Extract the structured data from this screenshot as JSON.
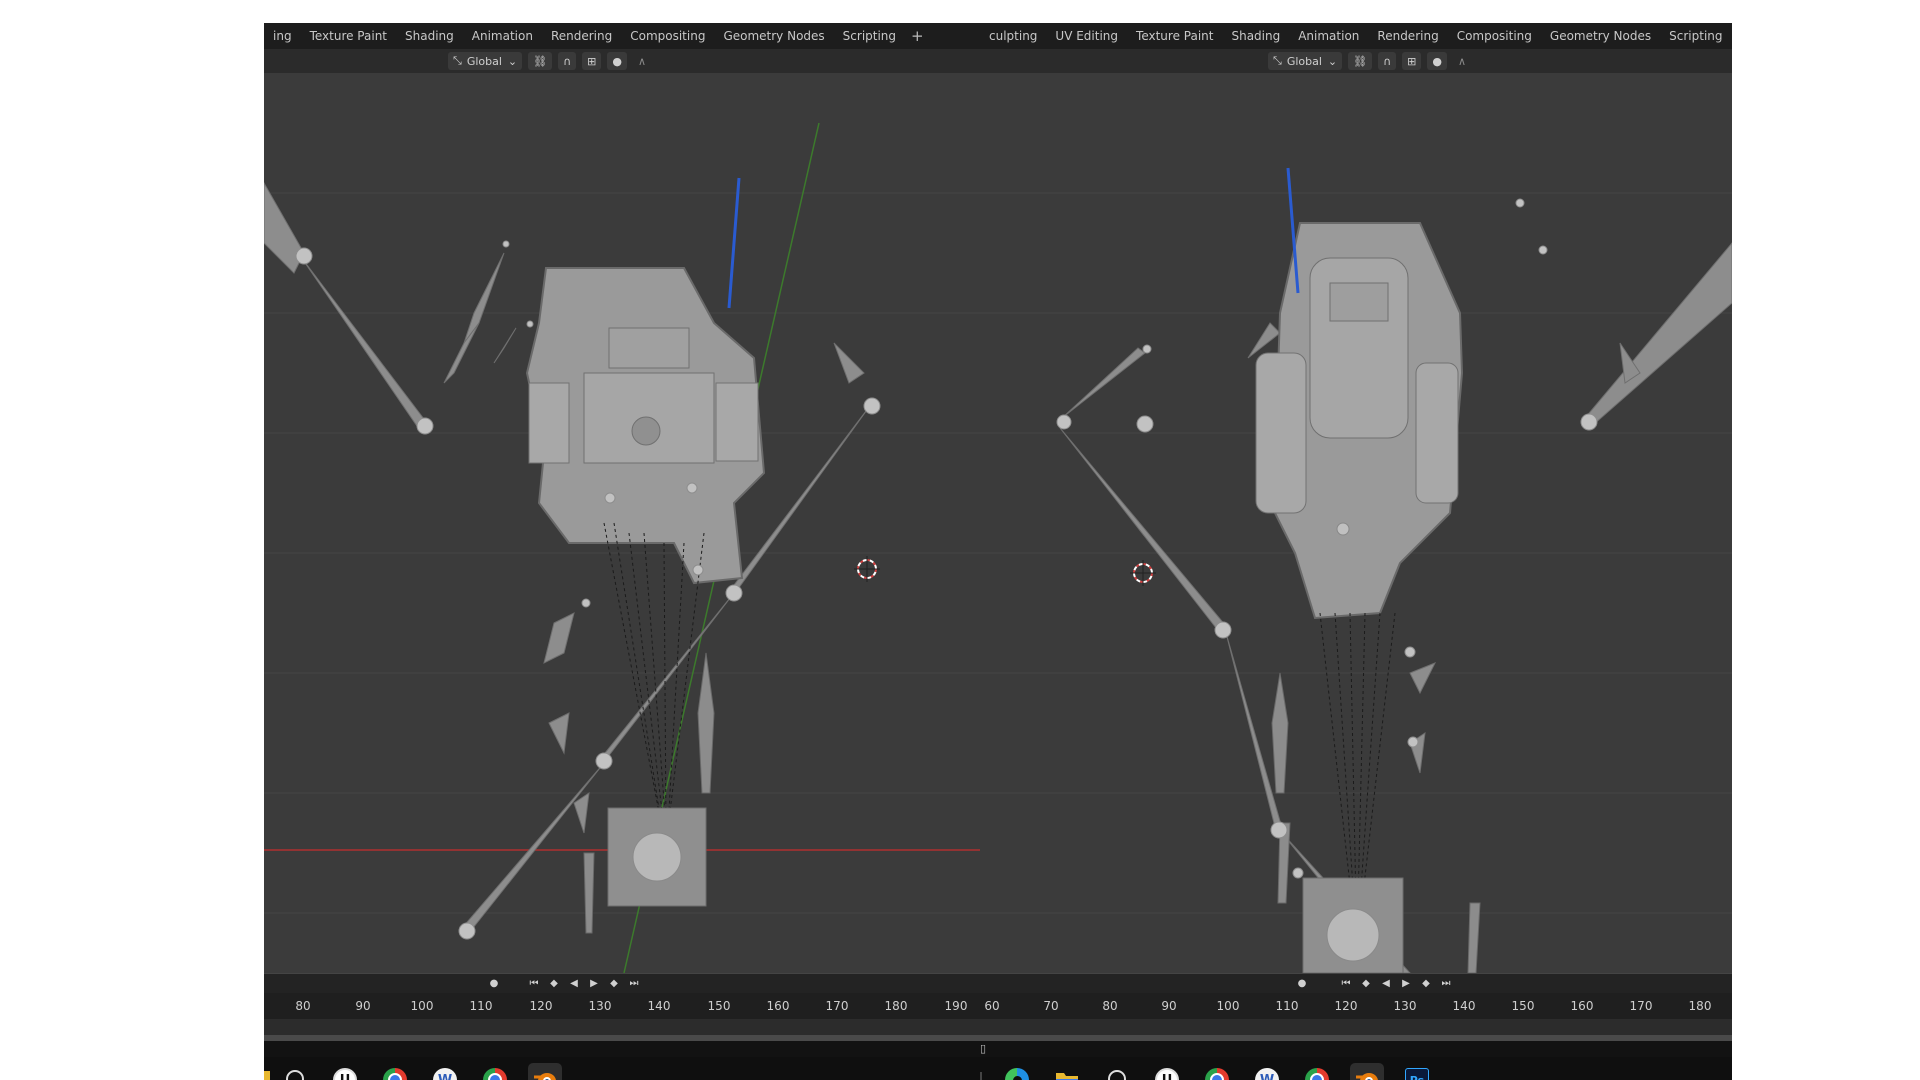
{
  "left_panel": {
    "tabs": [
      "ing",
      "Texture Paint",
      "Shading",
      "Animation",
      "Rendering",
      "Compositing",
      "Geometry Nodes",
      "Scripting"
    ],
    "add_label": "+",
    "transform_orientation": "Global",
    "timeline_ticks": [
      "80",
      "90",
      "100",
      "110",
      "120",
      "130",
      "140",
      "150",
      "160",
      "170",
      "180",
      "190"
    ]
  },
  "right_panel": {
    "tabs": [
      "culpting",
      "UV Editing",
      "Texture Paint",
      "Shading",
      "Animation",
      "Rendering",
      "Compositing",
      "Geometry Nodes",
      "Scripting"
    ],
    "add_label": "+",
    "transform_orientation": "Global",
    "timeline_ticks": [
      "60",
      "70",
      "80",
      "90",
      "100",
      "110",
      "120",
      "130",
      "140",
      "150",
      "160",
      "170",
      "180"
    ]
  },
  "playback_icons": [
    "record-dot-icon",
    "jump-start-icon",
    "prev-keyframe-icon",
    "play-reverse-icon",
    "play-icon",
    "next-keyframe-icon",
    "jump-end-icon"
  ],
  "taskbar_left": [
    {
      "icon": "file-explorer-partial-icon"
    },
    {
      "icon": "epic-launcher-icon"
    },
    {
      "icon": "unreal-engine-icon",
      "glyph": "U"
    },
    {
      "icon": "chrome-icon"
    },
    {
      "icon": "wps-writer-icon",
      "glyph": "W"
    },
    {
      "icon": "chrome-profile-icon"
    },
    {
      "icon": "blender-icon",
      "active": true
    }
  ],
  "taskbar_right": [
    {
      "icon": "edge-icon"
    },
    {
      "icon": "file-explorer-icon"
    },
    {
      "icon": "epic-launcher-icon"
    },
    {
      "icon": "unreal-engine-icon",
      "glyph": "U"
    },
    {
      "icon": "chrome-icon"
    },
    {
      "icon": "wps-writer-icon",
      "glyph": "W"
    },
    {
      "icon": "chrome-profile-icon"
    },
    {
      "icon": "blender-icon",
      "active": true
    },
    {
      "icon": "photoshop-icon",
      "glyph": "Ps"
    }
  ],
  "colors": {
    "viewport_bg": "#3b3b3b",
    "header_bg": "#1d1d1d",
    "mesh_gray": "#9a9a9a",
    "x_axis": "#b03030",
    "y_axis": "#3c7a2c",
    "z_axis_blue": "#2a5bd0",
    "cursor_red": "#d04040",
    "taskbar_bg": "#0f0f0f"
  }
}
